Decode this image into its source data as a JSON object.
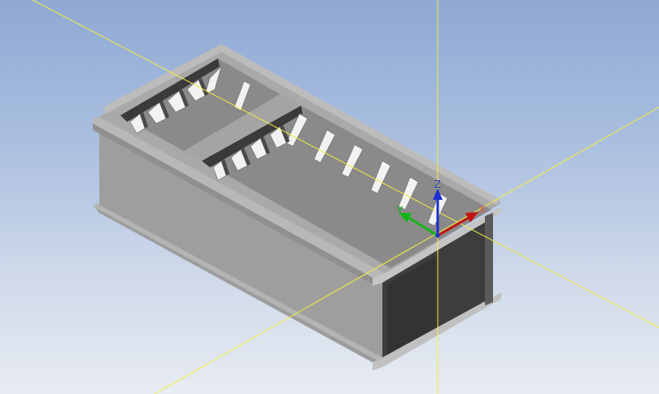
{
  "viewport": {
    "background_top": "#8fa9d4",
    "background_bottom": "#e8ecf2"
  },
  "triad": {
    "x_label": "X",
    "y_label": "Y",
    "z_label": "Z",
    "x_color": "#c41414",
    "y_color": "#16b41a",
    "z_color": "#1a2fd0"
  },
  "crosshair": {
    "color": "#f2ee3c"
  },
  "model": {
    "icon": "ribbed-channel-box-3d-model",
    "top_color": "#a8a8a8",
    "side_color": "#9a9a9a",
    "end_color": "#3c3c3c"
  }
}
